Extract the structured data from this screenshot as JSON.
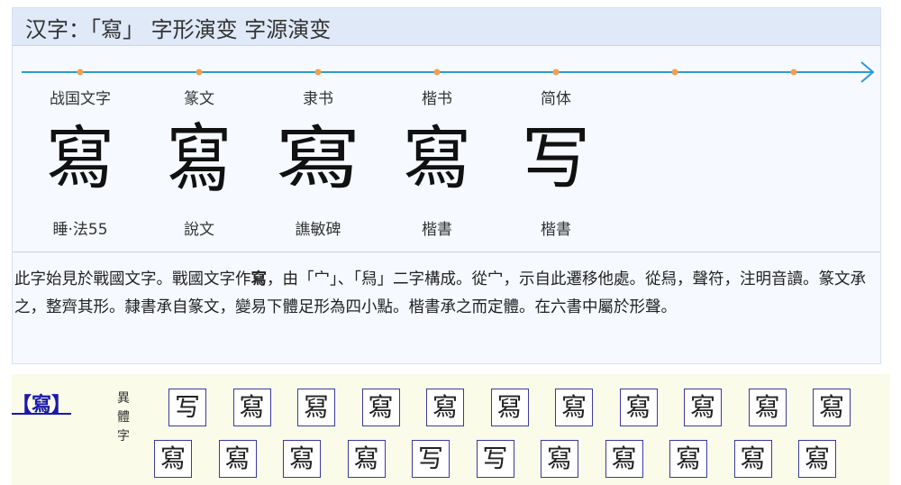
{
  "header": {
    "title": "汉字：「寫」 字形演变 字源演变"
  },
  "timeline": {
    "line_color": "#2b9ad6",
    "dot_color": "#f0a050",
    "stages": [
      {
        "era": "战国文字",
        "glyph": "寫",
        "source": "睡·法55"
      },
      {
        "era": "篆文",
        "glyph": "寫",
        "source": "說文"
      },
      {
        "era": "隶书",
        "glyph": "寫",
        "source": "譙敏碑"
      },
      {
        "era": "楷书",
        "glyph": "寫",
        "source": "楷書"
      },
      {
        "era": "简体",
        "glyph": "写",
        "source": "楷書"
      }
    ]
  },
  "description": {
    "before": "此字始見於戰國文字。戰國文字作",
    "glyph": "寫",
    "after": "，由「宀」、「舄」二字構成。從宀，示自此遷移他處。從舄，聲符，注明音讀。篆文承之，整齊其形。隸書承自篆文，變易下體足形為四小點。楷書承之而定體。在六書中屬於形聲。"
  },
  "variants": {
    "head": "【寫】",
    "label": "異體字",
    "row1": [
      "写",
      "寫",
      "冩",
      "寫",
      "寫",
      "冩",
      "寫",
      "寫",
      "寫",
      "寫",
      "寫"
    ],
    "row2": [
      "寫",
      "寫",
      "寫",
      "寫",
      "写",
      "写",
      "寫",
      "寫",
      "寫",
      "寫",
      "寫"
    ]
  }
}
